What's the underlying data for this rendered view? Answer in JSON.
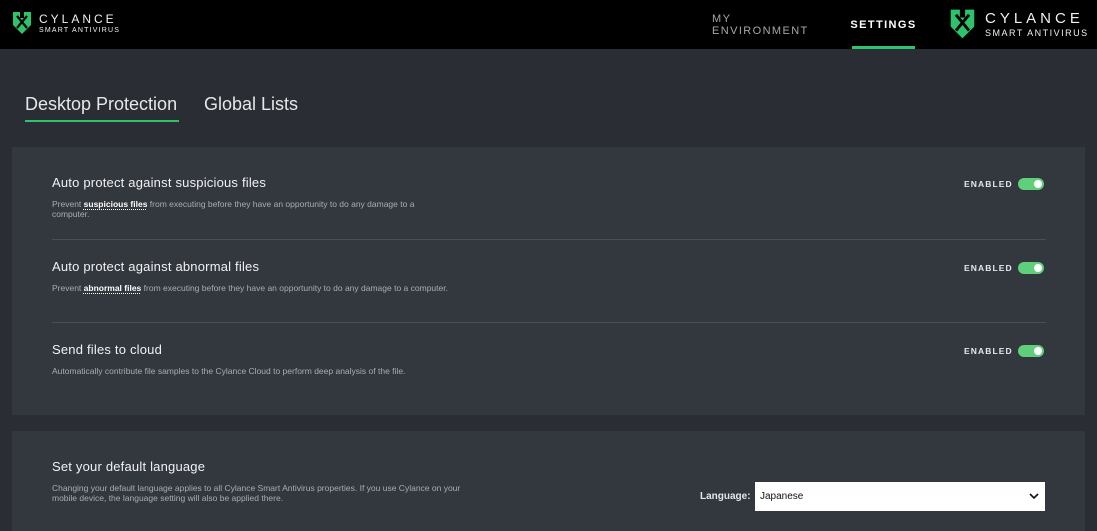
{
  "header": {
    "logo_left": {
      "brand": "CYLANCE",
      "product": "SMART ANTIVIRUS"
    },
    "logo_right": {
      "brand": "CYLANCE",
      "product": "SMART ANTIVIRUS"
    },
    "nav": [
      {
        "label": "MY ENVIRONMENT",
        "active": false
      },
      {
        "label": "SETTINGS",
        "active": true
      }
    ]
  },
  "tabs": [
    {
      "label": "Desktop Protection",
      "active": true
    },
    {
      "label": "Global Lists",
      "active": false
    }
  ],
  "settings": [
    {
      "title": "Auto protect against suspicious files",
      "desc_prefix": "Prevent ",
      "desc_strong": "suspicious files",
      "desc_suffix": " from executing before they have an opportunity to do any damage to a computer.",
      "status": "ENABLED",
      "enabled": true
    },
    {
      "title": "Auto protect against abnormal files",
      "desc_prefix": "Prevent ",
      "desc_strong": "abnormal files",
      "desc_suffix": " from executing before they have an opportunity to do any damage to a computer.",
      "status": "ENABLED",
      "enabled": true
    },
    {
      "title": "Send files to cloud",
      "desc": "Automatically contribute file samples to the Cylance Cloud to perform deep analysis of the file.",
      "status": "ENABLED",
      "enabled": true
    }
  ],
  "language": {
    "title": "Set your default language",
    "desc": "Changing your default language applies to all Cylance Smart Antivirus properties. If you use Cylance on your mobile device, the language setting will also be applied there.",
    "label": "Language:",
    "selected": "Japanese"
  },
  "colors": {
    "accent": "#2ec36b",
    "toggle_on": "#5fcf7b",
    "topbar": "#000000",
    "background": "#2a2d33",
    "panel": "#33373e"
  }
}
